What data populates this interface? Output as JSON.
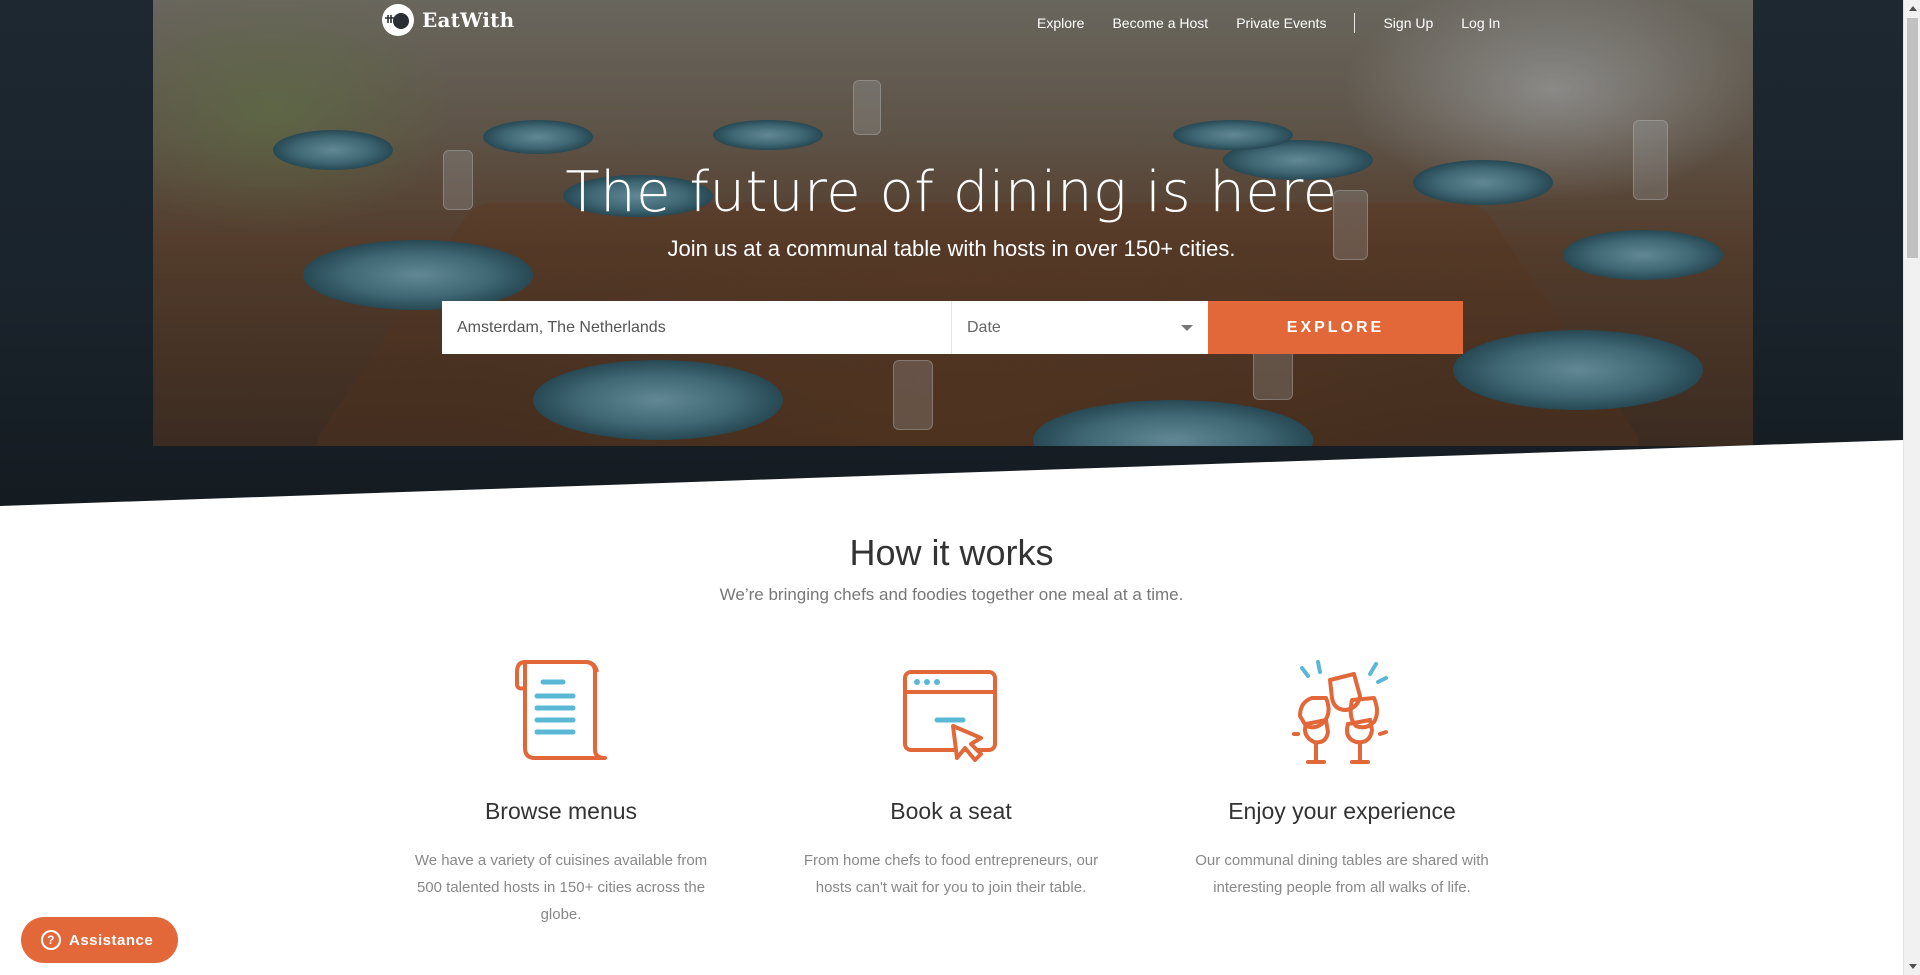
{
  "brand": {
    "name": "EatWith",
    "accent_color": "#e2683a",
    "secondary_icon_color": "#5ab8d6"
  },
  "nav": {
    "links": [
      "Explore",
      "Become a Host",
      "Private Events",
      "Sign Up",
      "Log In"
    ]
  },
  "hero": {
    "title": "The future of dining is here",
    "subtitle": "Join us at a communal table with hosts in over 150+ cities.",
    "search": {
      "location_value": "Amsterdam, The Netherlands",
      "date_placeholder": "Date",
      "button_label": "EXPLORE"
    }
  },
  "how_it_works": {
    "title": "How it works",
    "subtitle": "We’re bringing chefs and foodies together one meal at a time.",
    "steps": [
      {
        "icon": "menu-scroll-icon",
        "title": "Browse menus",
        "text": "We have a variety of cuisines available from 500 talented hosts in 150+ cities across the globe."
      },
      {
        "icon": "browser-click-icon",
        "title": "Book a seat",
        "text": "From home chefs to food entrepreneurs, our hosts can't wait for you to join their table."
      },
      {
        "icon": "wine-toast-icon",
        "title": "Enjoy your experience",
        "text": "Our communal dining tables are shared with interesting people from all walks of life."
      }
    ]
  },
  "assistance": {
    "label": "Assistance",
    "icon": "question-circle-icon"
  }
}
